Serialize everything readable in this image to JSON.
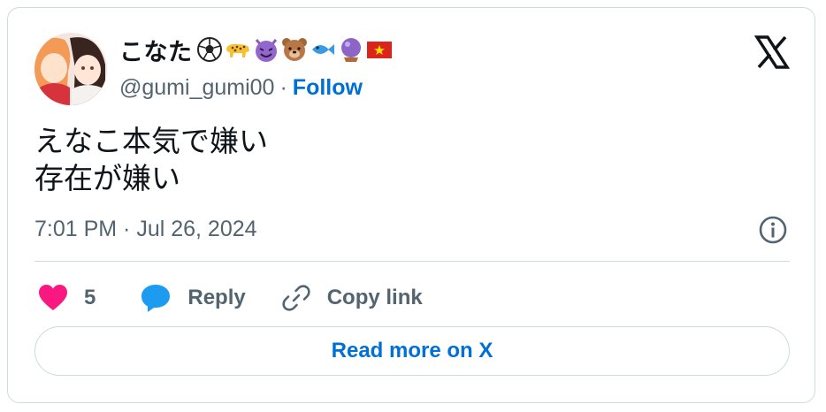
{
  "author": {
    "display_name": "こなた",
    "name_emojis": [
      "soccer-ball",
      "leopard",
      "smiling-devil",
      "bear",
      "fish",
      "crystal-ball",
      "vietnam-flag"
    ],
    "handle": "@gumi_gumi00",
    "separator": "·",
    "follow_label": "Follow"
  },
  "tweet": {
    "lines": [
      "えなこ本気で嫌い",
      "存在が嫌い"
    ],
    "timestamp": "7:01 PM · Jul 26, 2024"
  },
  "actions": {
    "like_count": "5",
    "reply_label": "Reply",
    "copy_label": "Copy link"
  },
  "footer": {
    "read_more_label": "Read more on X"
  },
  "colors": {
    "link_blue": "#006fd6",
    "heart_pink": "#f91880",
    "text_secondary": "#536471",
    "border": "#cfd9de"
  }
}
